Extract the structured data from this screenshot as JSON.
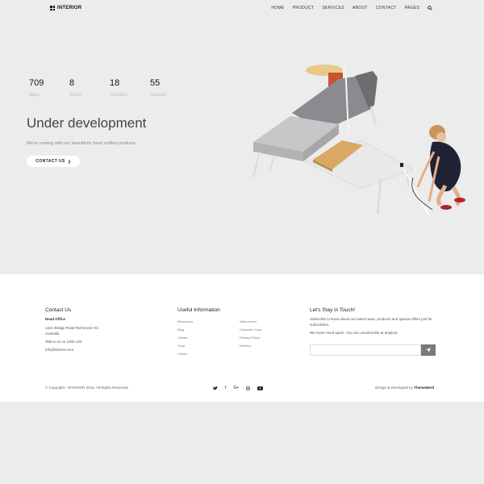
{
  "header": {
    "brand": "INTERIOR",
    "nav": [
      "HOME",
      "PRODUCT",
      "SERVICES",
      "ABOUT",
      "CONTACT",
      "PAGES"
    ]
  },
  "countdown": [
    {
      "value": "709",
      "label": "days"
    },
    {
      "value": "8",
      "label": "hours"
    },
    {
      "value": "18",
      "label": "minutes"
    },
    {
      "value": "55",
      "label": "second"
    }
  ],
  "hero": {
    "title": "Under development",
    "subtitle": "We're coming with our beautifully hand crafted products",
    "button": "CONTACT US"
  },
  "footer": {
    "contact": {
      "title": "Contact Us",
      "office_label": "Head Office",
      "address_line1": "132A Bridge Road Richmond VIC",
      "address_line2": "Australia",
      "phone": "Talk to us on 1300 132",
      "email": "info@interior.com"
    },
    "useful": {
      "title": "Useful Information",
      "left": [
        "Resources",
        "Blog",
        "Clients",
        "Trust",
        "Career"
      ],
      "right": [
        "Sales terms",
        "Customer Care",
        "Privacy Policy",
        "Delivery"
      ]
    },
    "newsletter": {
      "title": "Let's Stay in Touch!",
      "text1": "Subscribe to know about our latest news, products and special offers just for subscribers.",
      "text2": "We never send spam. You can unsubscribe at anytime."
    },
    "copyright": "© Copyright - INTERIOR 2016. All Rights Reserved.",
    "credit_prefix": "Design & Developed by",
    "credit_name": "ThemeNerd",
    "social_icons": [
      "twitter-icon",
      "facebook-icon",
      "google-plus-icon",
      "pinterest-icon",
      "youtube-icon"
    ]
  }
}
